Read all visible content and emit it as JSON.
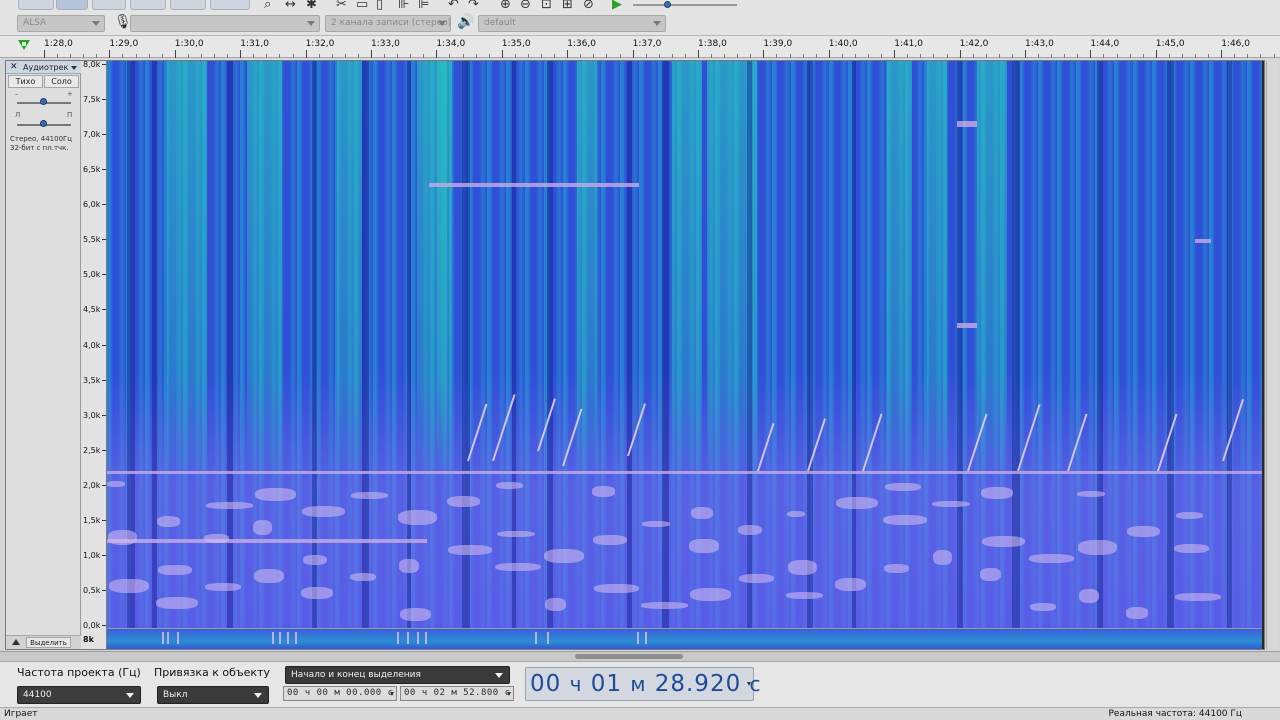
{
  "toolbar": {
    "host_combo": "ALSA",
    "mic_combo": "",
    "channels_combo": "2 канала записи (стерео)",
    "output_combo": "default",
    "icons": [
      "zoom-icon",
      "fit-selection-icon",
      "multi-tool-icon",
      "cut-icon",
      "copy-icon",
      "paste-icon",
      "trim-icon",
      "silence-icon",
      "undo-icon",
      "redo-icon",
      "zoom-in-icon",
      "zoom-out-icon",
      "fit-project-icon",
      "zoom-toggle-icon",
      "play-at-speed-icon"
    ]
  },
  "ruler": {
    "labels": [
      "1:28,0",
      "1:29,0",
      "1:30,0",
      "1:31,0",
      "1:32,0",
      "1:33,0",
      "1:34,0",
      "1:35,0",
      "1:36,0",
      "1:37,0",
      "1:38,0",
      "1:39,0",
      "1:40,0",
      "1:41,0",
      "1:42,0",
      "1:43,0",
      "1:44,0",
      "1:45,0",
      "1:46,0"
    ]
  },
  "track": {
    "name": "Аудиотрек",
    "mute_label": "Тихо",
    "solo_label": "Соло",
    "gain_min": "–",
    "gain_max": "+",
    "pan_left": "Л",
    "pan_right": "П",
    "info": "Стерео, 44100Гц\n32-бит с пл.тчк.",
    "select_label": "Выделить",
    "gain_level": 0.5,
    "pan_level": 0.5
  },
  "freq_axis": {
    "labels": [
      "8,0k",
      "7,5k",
      "7,0k",
      "6,5k",
      "6,0k",
      "5,5k",
      "5,0k",
      "4,5k",
      "4,0k",
      "3,5k",
      "3,0k",
      "2,5k",
      "2,0k",
      "1,5k",
      "1,0k",
      "0,5k",
      "0,0k"
    ],
    "bottom_label": "8k"
  },
  "selection_bar": {
    "project_rate_label": "Частота проекта (Гц)",
    "project_rate_value": "44100",
    "snap_label": "Привязка к объекту",
    "snap_value": "Выкл",
    "selection_mode": "Начало и конец выделения",
    "start_time": "00 ч 00 м 00.000 с",
    "end_time": "00 ч 02 м 52.800 с",
    "clock_hours": "00",
    "clock_h_unit": "ч",
    "clock_minutes": "01",
    "clock_m_unit": "м",
    "clock_seconds": "28.920",
    "clock_s_unit": "с"
  },
  "status": {
    "state": "Играет",
    "actual_rate": "Реальная частота: 44100 Гц"
  },
  "colors": {
    "spectrogram_base": "#2f4fd7",
    "spectrogram_highlight": "#28c8be",
    "clock_text": "#1e4b97",
    "play_green": "#2aa22a"
  }
}
